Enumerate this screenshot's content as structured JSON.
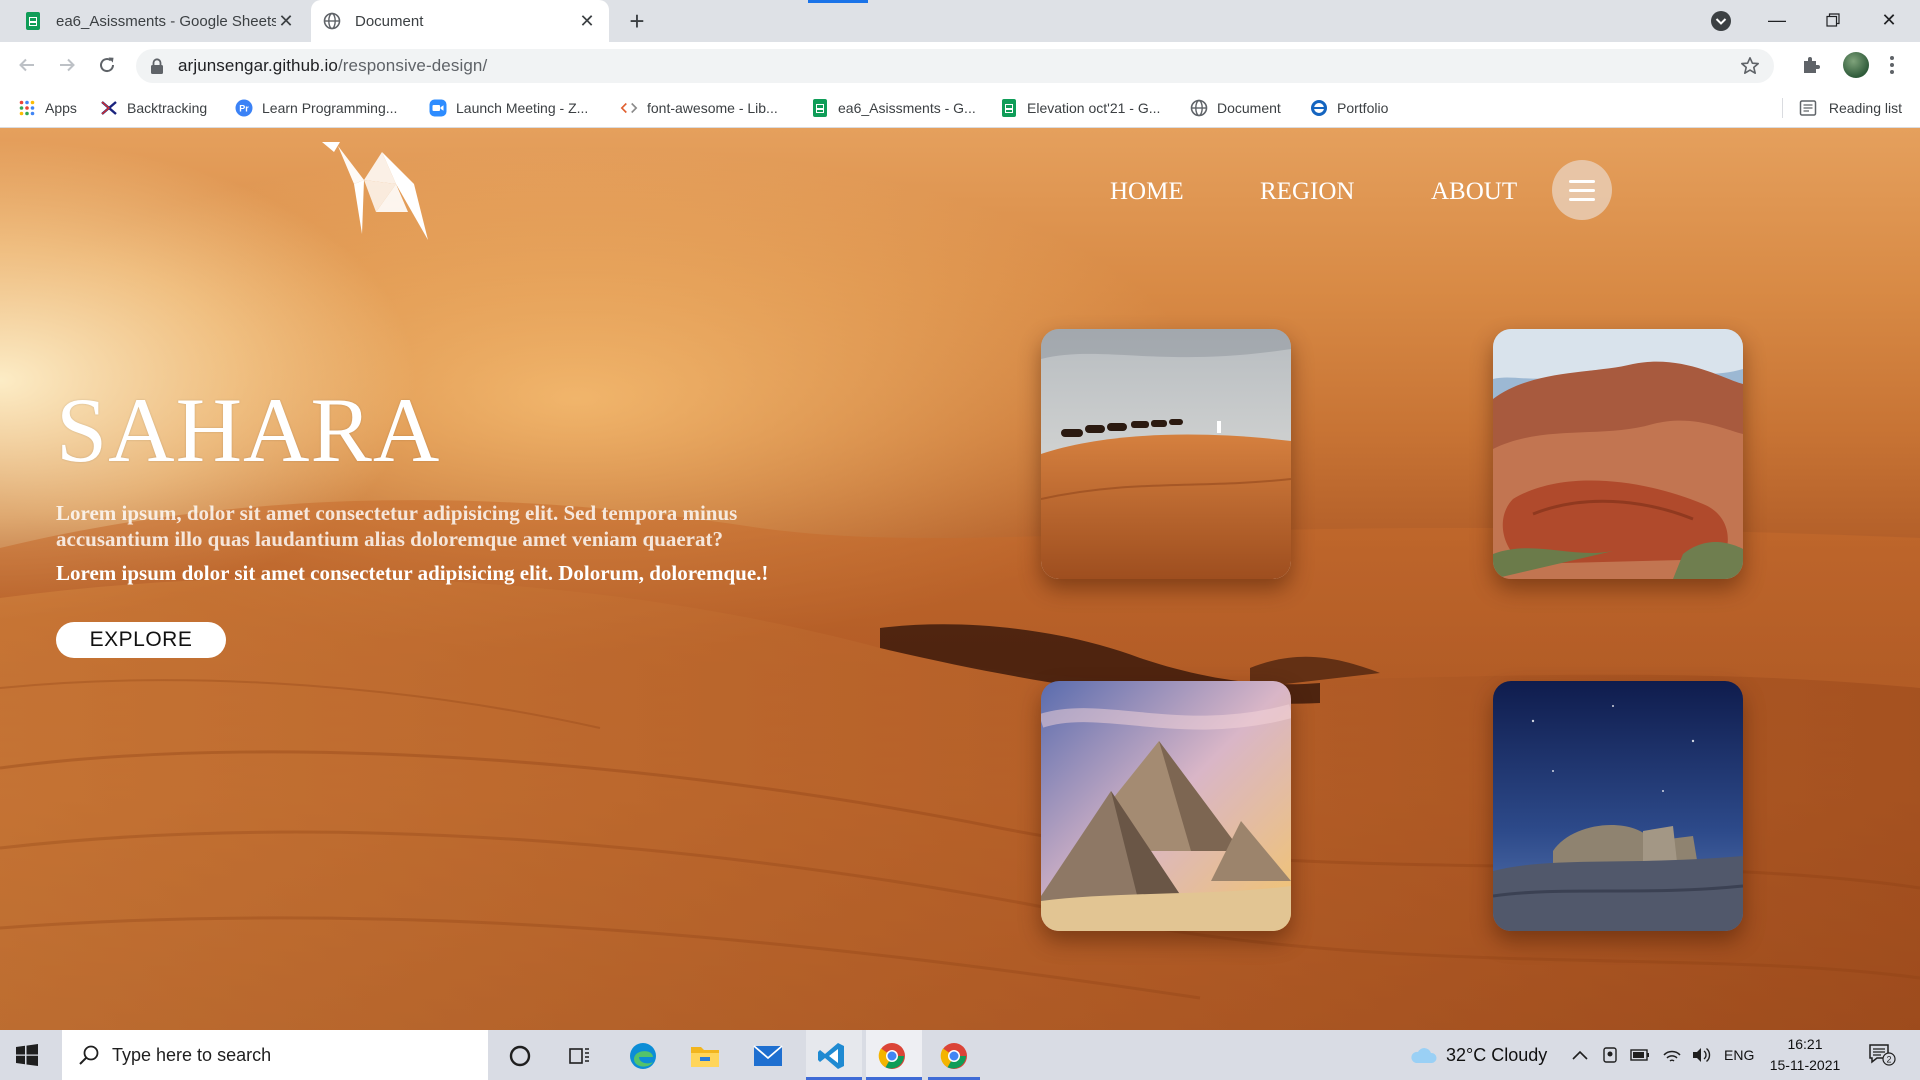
{
  "browser": {
    "tabs": [
      {
        "title": "ea6_Asissments - Google Sheets",
        "icon": "google-sheets-icon",
        "active": false
      },
      {
        "title": "Document",
        "icon": "globe-icon",
        "active": true
      }
    ],
    "new_tab_label": "+",
    "url_host": "arjunsengar.github.io",
    "url_path": "/responsive-design/",
    "bookmarks": [
      {
        "label": "Apps",
        "icon": "apps-grid-icon"
      },
      {
        "label": "Backtracking",
        "icon": "bookmark-site-icon"
      },
      {
        "label": "Learn Programming...",
        "icon": "programiz-icon"
      },
      {
        "label": "Launch Meeting - Z...",
        "icon": "zoom-icon"
      },
      {
        "label": "font-awesome - Lib...",
        "icon": "code-icon"
      },
      {
        "label": "ea6_Asissments - G...",
        "icon": "google-sheets-icon"
      },
      {
        "label": "Elevation oct'21 - G...",
        "icon": "google-sheets-icon"
      },
      {
        "label": "Document",
        "icon": "globe-icon"
      },
      {
        "label": "Portfolio",
        "icon": "portfolio-icon"
      }
    ],
    "reading_list": "Reading list"
  },
  "page": {
    "nav": [
      "HOME",
      "REGION",
      "ABOUT"
    ],
    "hero_title": "SAHARA",
    "hero_paragraph_1": "Lorem ipsum, dolor sit amet consectetur adipisicing elit. Sed tempora minus accusantium illo quas laudantium alias doloremque amet veniam quaerat?",
    "hero_paragraph_2": "Lorem ipsum dolor sit amet consectetur adipisicing elit. Dolorum, doloremque.!",
    "explore_label": "EXPLORE",
    "cards": [
      "camel-caravan-photo",
      "red-rock-canyon-photo",
      "pyramids-photo",
      "night-desert-ruins-photo"
    ]
  },
  "taskbar": {
    "search_placeholder": "Type here to search",
    "weather": "32°C  Cloudy",
    "language": "ENG",
    "time": "16:21",
    "date": "15-11-2021",
    "notification_count": "2"
  },
  "colors": {
    "accent": "#1a73e8",
    "sheets_green": "#0f9d58",
    "desert_orange": "#c77334"
  }
}
